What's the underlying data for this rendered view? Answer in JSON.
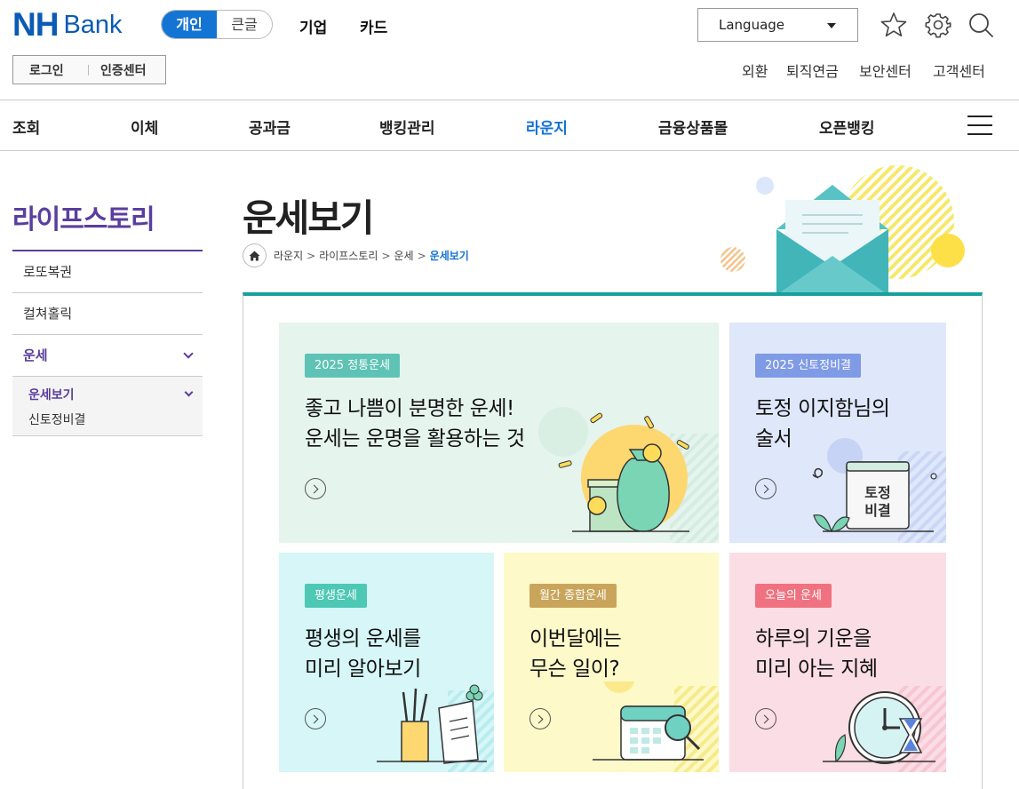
{
  "header": {
    "logo_nh": "NH",
    "logo_bank": "Bank",
    "segment": [
      "개인",
      "큰글"
    ],
    "top_nav": [
      "기업",
      "카드"
    ],
    "language_label": "Language",
    "icons": [
      "star-icon",
      "gear-icon",
      "search-icon"
    ],
    "login": "로그인",
    "cert_center": "인증센터",
    "util_links": [
      "외환",
      "퇴직연금",
      "보안센터",
      "고객센터"
    ]
  },
  "gnb": [
    "조회",
    "이체",
    "공과금",
    "뱅킹관리",
    "라운지",
    "금융상품몰",
    "오픈뱅킹"
  ],
  "gnb_active": "라운지",
  "lnb": {
    "title": "라이프스토리",
    "items": [
      "로또복권",
      "컬쳐홀릭",
      "운세"
    ],
    "sub_items": [
      "운세보기",
      "신토정비결"
    ]
  },
  "page": {
    "title": "운세보기",
    "breadcrumb": [
      "라운지",
      "라이프스토리",
      "운세",
      "운세보기"
    ]
  },
  "cards": [
    {
      "badge": "2025 정통운세",
      "line1": "좋고 나쁨이 분명한 운세!",
      "line2": "운세는 운명을 활용하는 것",
      "bg": "#e6f4ee",
      "badge_color": "#5ec3b5"
    },
    {
      "badge": "2025 신토정비결",
      "line1": "토정 이지함님의",
      "line2": "술서",
      "bg": "#dfe7fb",
      "badge_color": "#7f9be6",
      "art_text1": "토정",
      "art_text2": "비결"
    },
    {
      "badge": "평생운세",
      "line1": "평생의 운세를",
      "line2": "미리 알아보기",
      "bg": "#d6f6f7",
      "badge_color": "#4cc8b4"
    },
    {
      "badge": "월간 종합운세",
      "line1": "이번달에는",
      "line2": "무슨 일이?",
      "bg": "#fdf9c9",
      "badge_color": "#c9a55c"
    },
    {
      "badge": "오늘의 운세",
      "line1": "하루의 기운을",
      "line2": "미리 아는 지혜",
      "bg": "#fbdde6",
      "badge_color": "#f07280"
    }
  ],
  "colors": {
    "brand": "#0a5bb5",
    "accent": "#1474d4",
    "lnb": "#5a3e9e",
    "content_top": "#16a19c"
  }
}
